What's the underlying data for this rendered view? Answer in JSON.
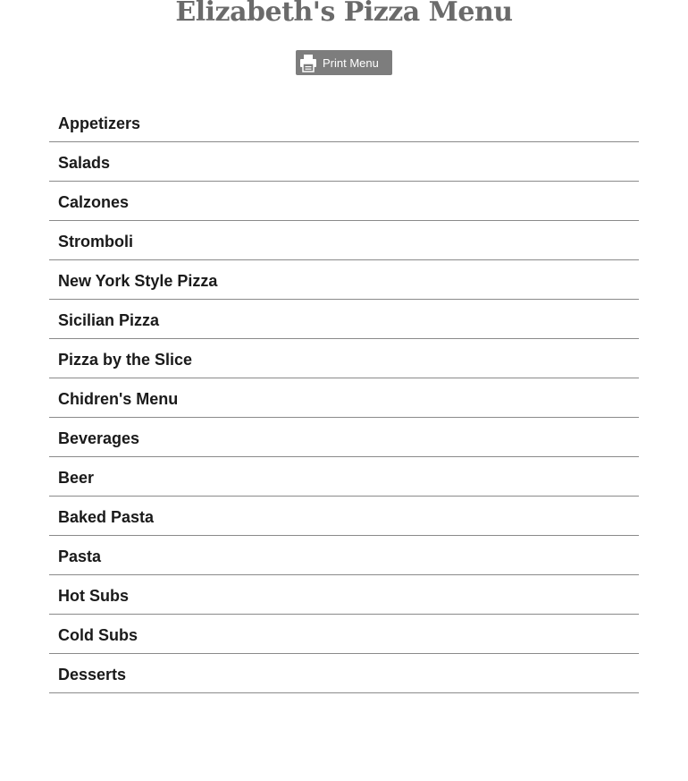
{
  "page": {
    "title": "Elizabeth's Pizza Menu"
  },
  "toolbar": {
    "print_label": "Print Menu",
    "print_icon": "printer-icon"
  },
  "menu": {
    "items": [
      {
        "label": "Appetizers",
        "name": "menu-item-appetizers"
      },
      {
        "label": "Salads",
        "name": "menu-item-salads"
      },
      {
        "label": "Calzones",
        "name": "menu-item-calzones"
      },
      {
        "label": "Stromboli",
        "name": "menu-item-stromboli"
      },
      {
        "label": "New York Style Pizza",
        "name": "menu-item-new-york-style-pizza"
      },
      {
        "label": "Sicilian Pizza",
        "name": "menu-item-sicilian-pizza"
      },
      {
        "label": "Pizza by the Slice",
        "name": "menu-item-pizza-by-the-slice"
      },
      {
        "label": "Chidren's Menu",
        "name": "menu-item-childrens-menu"
      },
      {
        "label": "Beverages",
        "name": "menu-item-beverages"
      },
      {
        "label": "Beer",
        "name": "menu-item-beer"
      },
      {
        "label": "Baked Pasta",
        "name": "menu-item-baked-pasta"
      },
      {
        "label": "Pasta",
        "name": "menu-item-pasta"
      },
      {
        "label": "Hot Subs",
        "name": "menu-item-hot-subs"
      },
      {
        "label": "Cold Subs",
        "name": "menu-item-cold-subs"
      },
      {
        "label": "Desserts",
        "name": "menu-item-desserts"
      }
    ]
  },
  "colors": {
    "title": "#6a6a6a",
    "button_bg": "#7d7d7d",
    "divider": "#8a8a8a",
    "item_text": "#1a1a1a"
  }
}
